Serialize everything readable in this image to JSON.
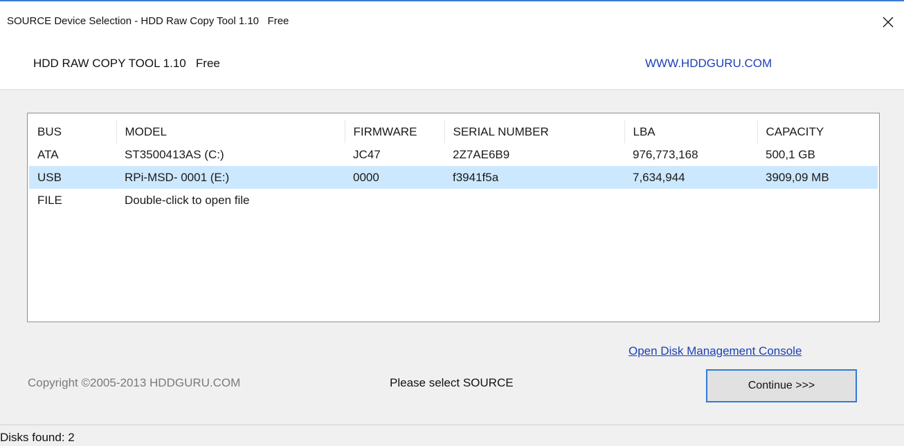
{
  "window": {
    "title": "SOURCE Device Selection - HDD Raw Copy Tool 1.10   Free"
  },
  "header": {
    "app_name": "HDD RAW COPY TOOL 1.10   Free",
    "website": "WWW.HDDGURU.COM"
  },
  "device_list": {
    "columns": [
      "BUS",
      "MODEL",
      "FIRMWARE",
      "SERIAL NUMBER",
      "LBA",
      "CAPACITY"
    ],
    "rows": [
      {
        "bus": "ATA",
        "model": "ST3500413AS (C:)",
        "firmware": "JC47",
        "serial": "2Z7AE6B9",
        "lba": "976,773,168",
        "capacity": "500,1 GB",
        "selected": false
      },
      {
        "bus": "USB",
        "model": "RPi-MSD- 0001 (E:)",
        "firmware": "0000",
        "serial": "f3941f5a",
        "lba": "7,634,944",
        "capacity": "3909,09 MB",
        "selected": true
      },
      {
        "bus": "FILE",
        "model": "Double-click to open file",
        "firmware": "",
        "serial": "",
        "lba": "",
        "capacity": "",
        "selected": false
      }
    ]
  },
  "footer": {
    "disk_mgmt_link": "Open Disk Management Console",
    "copyright": "Copyright ©2005-2013 HDDGURU.COM",
    "status_message": "Please select SOURCE",
    "continue_label": "Continue >>>"
  },
  "statusbar": {
    "text": "Disks found: 2"
  },
  "colors": {
    "accent": "#2f7ad6",
    "link": "#1a3fb8",
    "selection": "#cce8ff"
  },
  "icons": {
    "close": "close-icon"
  }
}
